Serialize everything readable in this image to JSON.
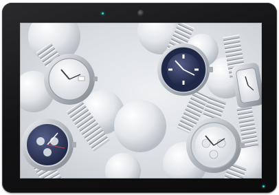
{
  "device": {
    "type": "tablet-display",
    "bezel_color": "#141416",
    "indicator_color": "#2fd0c6"
  },
  "wallpaper": {
    "subject": "luxury-watches-on-white-spheres",
    "accent_colors": {
      "navy": "#2a3354",
      "steel": "#b9bec5",
      "background": "#e4e7ea"
    }
  }
}
